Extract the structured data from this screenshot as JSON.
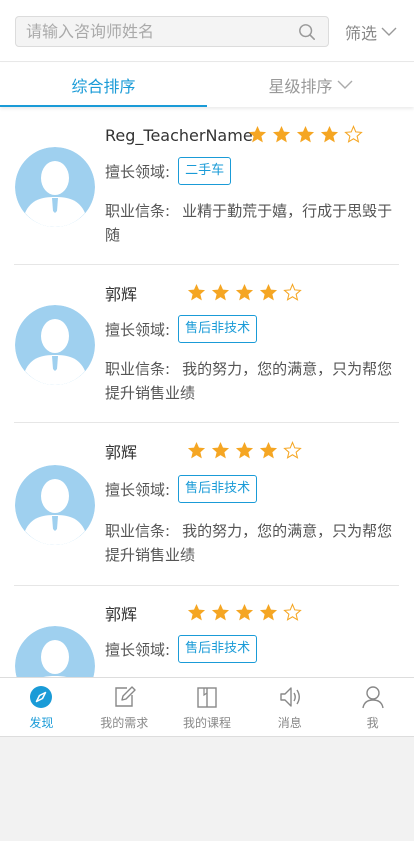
{
  "search": {
    "placeholder": "请输入咨询师姓名",
    "icon": "search-icon"
  },
  "filter": {
    "label": "筛选",
    "icon": "chevron-down-icon"
  },
  "tabs": [
    {
      "label": "综合排序",
      "active": true
    },
    {
      "label": "星级排序",
      "active": false,
      "icon": "chevron-down-icon"
    }
  ],
  "labels": {
    "expertise": "擅长领域:",
    "motto": "职业信条:"
  },
  "colors": {
    "accent": "#1a9bd7",
    "star": "#f5a623",
    "avatar": "#9fd0ef"
  },
  "teachers": [
    {
      "name": "Reg_TeacherName",
      "rating": 4,
      "max_rating": 5,
      "tag": "二手车",
      "motto": "业精于勤荒于嬉，行成于思毁于随"
    },
    {
      "name": "郭辉",
      "rating": 4,
      "max_rating": 5,
      "tag": "售后非技术",
      "motto": "我的努力，您的满意，只为帮您提升销售业绩"
    },
    {
      "name": "郭辉",
      "rating": 4,
      "max_rating": 5,
      "tag": "售后非技术",
      "motto": "我的努力，您的满意，只为帮您提升销售业绩"
    },
    {
      "name": "郭辉",
      "rating": 4,
      "max_rating": 5,
      "tag": "售后非技术",
      "motto": ""
    }
  ],
  "tabbar": [
    {
      "label": "发现",
      "icon": "compass-icon",
      "active": true
    },
    {
      "label": "我的需求",
      "icon": "edit-icon",
      "active": false
    },
    {
      "label": "我的课程",
      "icon": "book-icon",
      "active": false
    },
    {
      "label": "消息",
      "icon": "speaker-icon",
      "active": false
    },
    {
      "label": "我",
      "icon": "user-icon",
      "active": false
    }
  ]
}
